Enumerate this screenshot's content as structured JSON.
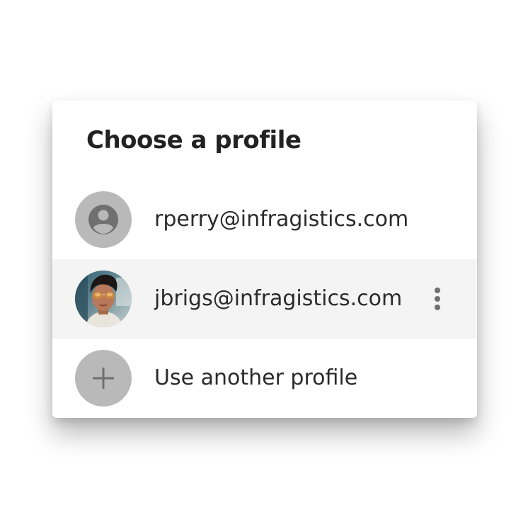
{
  "dialog": {
    "title": "Choose a profile",
    "profiles": [
      {
        "label": "rperry@infragistics.com",
        "avatar_icon": "account-circle-icon",
        "selected": false
      },
      {
        "label": "jbrigs@infragistics.com",
        "avatar_icon": "user-photo",
        "selected": true,
        "menu_icon": "more-vertical-icon"
      }
    ],
    "add_profile": {
      "label": "Use another profile",
      "icon": "plus-icon"
    }
  },
  "colors": {
    "avatar_bg": "#b9b9b9",
    "icon_dark": "#707070",
    "selected_row_bg": "#f4f4f4",
    "text": "#2b2b2b",
    "title": "#222222"
  }
}
